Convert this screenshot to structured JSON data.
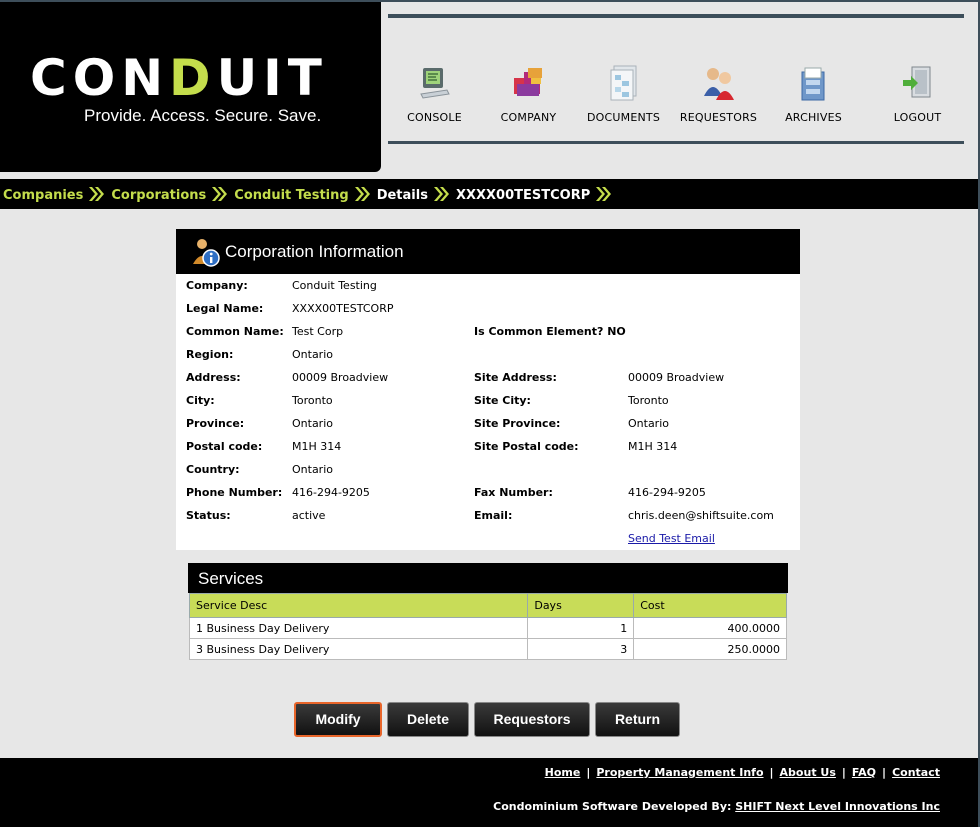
{
  "brand": {
    "logo_main": "CON",
    "logo_accent": "D",
    "logo_rest": "UIT",
    "tagline": "Provide. Access. Secure. Save.",
    "accent_color": "#c4dd4c"
  },
  "nav": [
    {
      "label": "CONSOLE",
      "icon": "console-icon"
    },
    {
      "label": "COMPANY",
      "icon": "company-icon"
    },
    {
      "label": "DOCUMENTS",
      "icon": "documents-icon"
    },
    {
      "label": "REQUESTORS",
      "icon": "requestors-icon"
    },
    {
      "label": "ARCHIVES",
      "icon": "archives-icon"
    },
    {
      "label": "LOGOUT",
      "icon": "logout-icon"
    }
  ],
  "breadcrumb": [
    "Companies",
    "Corporations",
    "Conduit Testing",
    "Details",
    "XXXX00TESTCORP"
  ],
  "corp_info": {
    "title": "Corporation Information",
    "fields": {
      "company": {
        "label": "Company:",
        "value": "Conduit Testing"
      },
      "legal_name": {
        "label": "Legal Name:",
        "value": "XXXX00TESTCORP"
      },
      "common_name": {
        "label": "Common Name:",
        "value": "Test Corp"
      },
      "common_element": {
        "label": "Is Common Element? NO"
      },
      "region": {
        "label": "Region:",
        "value": "Ontario"
      },
      "address": {
        "label": "Address:",
        "value": "00009 Broadview"
      },
      "site_address": {
        "label": "Site Address:",
        "value": "00009 Broadview"
      },
      "city": {
        "label": "City:",
        "value": "Toronto"
      },
      "site_city": {
        "label": "Site City:",
        "value": "Toronto"
      },
      "province": {
        "label": "Province:",
        "value": "Ontario"
      },
      "site_province": {
        "label": "Site Province:",
        "value": "Ontario"
      },
      "postal_code": {
        "label": "Postal code:",
        "value": "M1H 314"
      },
      "site_postal_code": {
        "label": "Site Postal code:",
        "value": "M1H 314"
      },
      "country": {
        "label": "Country:",
        "value": "Ontario"
      },
      "phone": {
        "label": "Phone Number:",
        "value": "416-294-9205"
      },
      "fax": {
        "label": "Fax Number:",
        "value": "416-294-9205"
      },
      "status": {
        "label": "Status:",
        "value": "active"
      },
      "email": {
        "label": "Email:",
        "value": "chris.deen@shiftsuite.com"
      }
    },
    "send_test_email": "Send Test Email"
  },
  "services": {
    "title": "Services",
    "columns": [
      "Service Desc",
      "Days",
      "Cost"
    ],
    "rows": [
      [
        "1 Business Day Delivery",
        "1",
        "400.0000"
      ],
      [
        "3 Business Day Delivery",
        "3",
        "250.0000"
      ]
    ]
  },
  "actions": {
    "modify": "Modify",
    "delete": "Delete",
    "requestors": "Requestors",
    "return": "Return"
  },
  "footer": {
    "links": [
      "Home",
      "Property Management Info",
      "About Us",
      "FAQ",
      "Contact"
    ],
    "sep": "|",
    "credit_prefix": "Condominium Software Developed By:",
    "credit_link": "SHIFT Next Level Innovations Inc"
  }
}
